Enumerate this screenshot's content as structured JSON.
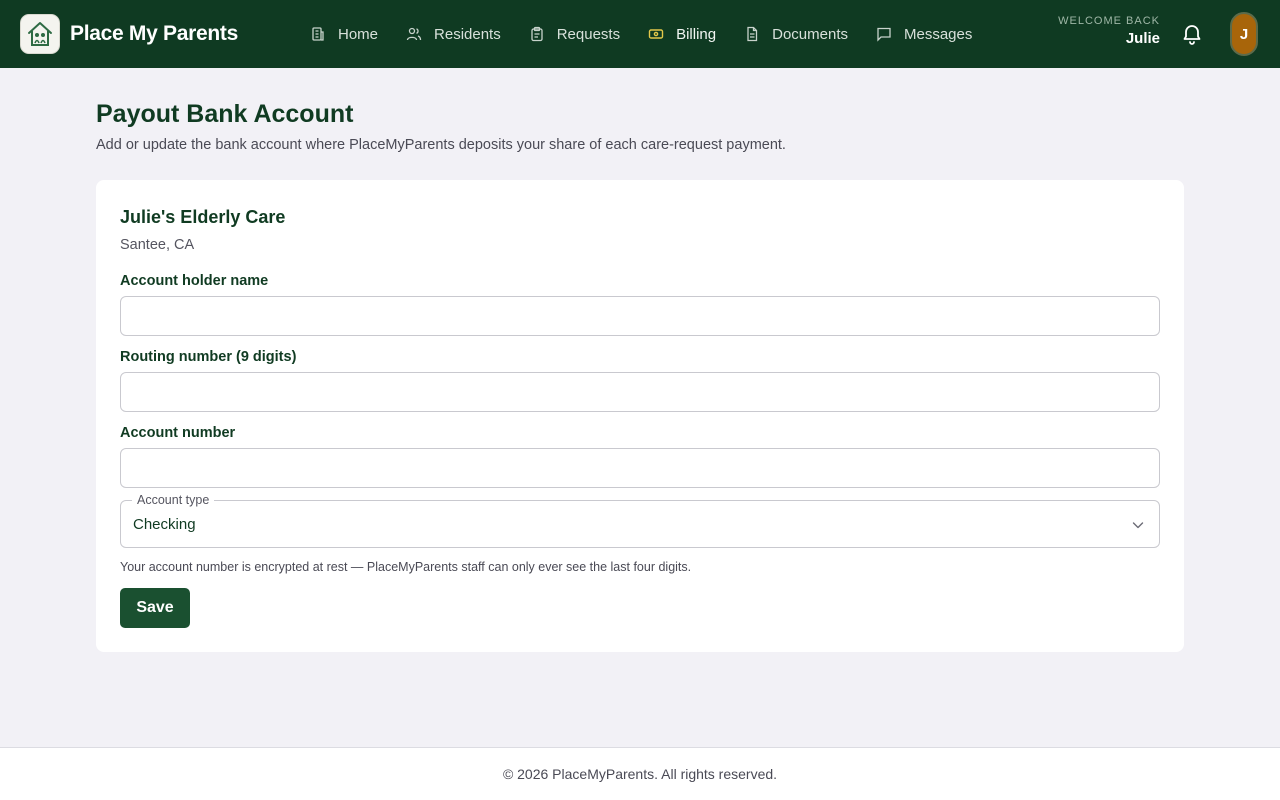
{
  "header": {
    "brand_name": "Place My Parents",
    "nav": [
      {
        "label": "Home",
        "icon": "building-icon"
      },
      {
        "label": "Residents",
        "icon": "users-icon"
      },
      {
        "label": "Requests",
        "icon": "clipboard-icon"
      },
      {
        "label": "Billing",
        "icon": "banknote-icon"
      },
      {
        "label": "Documents",
        "icon": "document-icon"
      },
      {
        "label": "Messages",
        "icon": "message-icon"
      }
    ],
    "welcome_label": "WELCOME BACK",
    "welcome_name": "Julie",
    "avatar_initial": "J",
    "colors": {
      "bar": "#0f3a22",
      "avatar": "#a8650a",
      "billing_icon": "#e3c84a"
    }
  },
  "main": {
    "title": "Payout Bank Account",
    "subtitle": "Add or update the bank account where PlaceMyParents deposits your share of each care-request payment.",
    "card": {
      "org_name": "Julie's Elderly Care",
      "org_location": "Santee, CA",
      "fields": [
        {
          "label": "Account holder name",
          "value": ""
        },
        {
          "label": "Routing number (9 digits)",
          "value": ""
        },
        {
          "label": "Account number",
          "value": ""
        }
      ],
      "account_type": {
        "label": "Account type",
        "value": "Checking"
      },
      "hint": "Your account number is encrypted at rest — PlaceMyParents staff can only ever see the last four digits.",
      "save_label": "Save",
      "save_color": "#1a5030"
    }
  },
  "footer": {
    "text": "© 2026 PlaceMyParents. All rights reserved."
  }
}
